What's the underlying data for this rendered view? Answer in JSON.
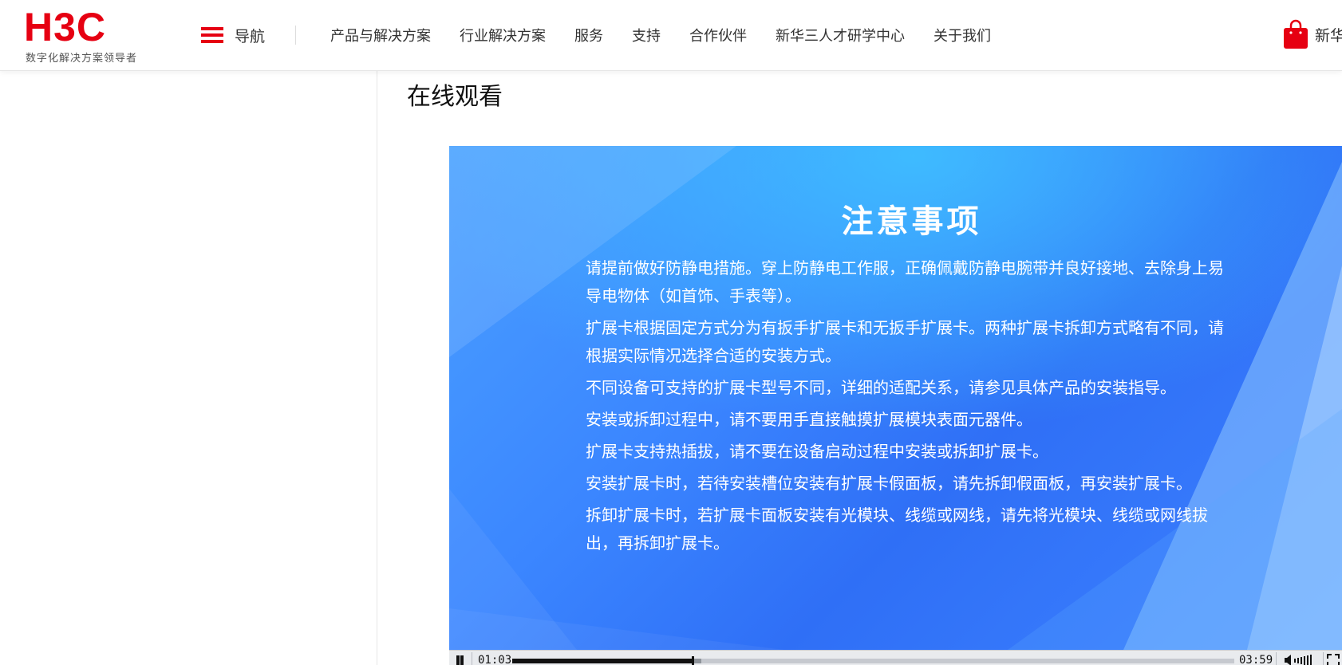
{
  "header": {
    "logo_text": "H3C",
    "logo_slogan": "数字化解决方案领导者",
    "nav_toggle_label": "导航",
    "menu": [
      {
        "label": "产品与解决方案"
      },
      {
        "label": "行业解决方案"
      },
      {
        "label": "服务"
      },
      {
        "label": "支持"
      },
      {
        "label": "合作伙伴"
      },
      {
        "label": "新华三人才研学中心"
      },
      {
        "label": "关于我们"
      }
    ],
    "cart_label": "新华"
  },
  "main": {
    "section_title": "在线观看"
  },
  "video": {
    "slide_title": "注意事项",
    "notes": [
      "请提前做好防静电措施。穿上防静电工作服，正确佩戴防静电腕带并良好接地、去除身上易导电物体（如首饰、手表等）。",
      "扩展卡根据固定方式分为有扳手扩展卡和无扳手扩展卡。两种扩展卡拆卸方式略有不同，请根据实际情况选择合适的安装方式。",
      "不同设备可支持的扩展卡型号不同，详细的适配关系，请参见具体产品的安装指导。",
      "安装或拆卸过程中，请不要用手直接触摸扩展模块表面元器件。",
      "扩展卡支持热插拔，请不要在设备启动过程中安装或拆卸扩展卡。",
      "安装扩展卡时，若待安装槽位安装有扩展卡假面板，请先拆卸假面板，再安装扩展卡。",
      "拆卸扩展卡时，若扩展卡面板安装有光模块、线缆或网线，请先将光模块、线缆或网线拔出，再拆卸扩展卡。"
    ],
    "controls": {
      "current_time": "01:03",
      "total_time": "03:59",
      "progress_fraction": 0.25,
      "buffered_fraction": 0.262
    }
  },
  "colors": {
    "brand_red": "#e60012",
    "slide_blue": "#3b86ff"
  },
  "icons": {
    "menu": "hamburger-icon",
    "cart": "shopping-bag-icon",
    "pause": "pause-icon",
    "volume": "volume-icon",
    "fullscreen": "fullscreen-icon"
  }
}
